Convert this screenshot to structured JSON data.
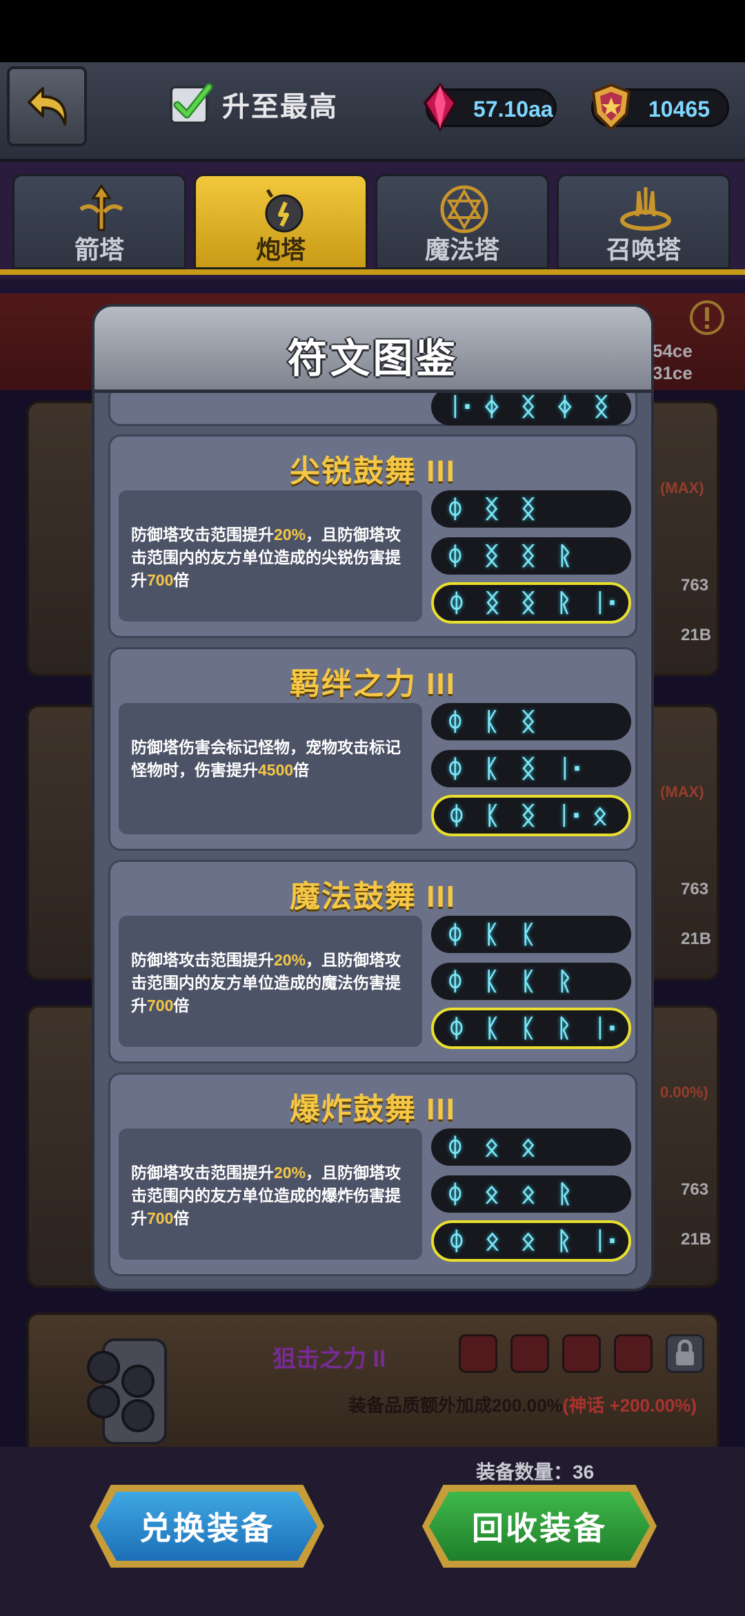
{
  "topbar": {
    "max_label": "升至最高",
    "gem_value": "57.10aa",
    "gold_value": "10465"
  },
  "tabs": [
    {
      "label": "箭塔",
      "active": false
    },
    {
      "label": "炮塔",
      "active": true
    },
    {
      "label": "魔法塔",
      "active": false
    },
    {
      "label": "召唤塔",
      "active": false
    }
  ],
  "modal": {
    "title": "符文图鉴",
    "top_partial_glyphs": [
      "ᛁ·",
      "ᛄ",
      "ᛝ",
      "ᛄ",
      "ᛝ"
    ],
    "cards": [
      {
        "title": "尖锐鼓舞 III",
        "desc_parts": [
          "防御塔攻击范围提升",
          "20%",
          "，且防御塔攻击范围内的友方单位造成的尖锐伤害提升",
          "700",
          "倍"
        ],
        "combos": [
          [
            "ᛰ",
            "ᛝ",
            "ᛝ"
          ],
          [
            "ᛰ",
            "ᛝ",
            "ᛝ",
            "ᚱ"
          ],
          [
            "ᛰ",
            "ᛝ",
            "ᛝ",
            "ᚱ",
            "ᛁ·"
          ]
        ]
      },
      {
        "title": "羁绊之力 III",
        "desc_parts": [
          "防御塔伤害会标记怪物，宠物攻击标记怪物时，伤害提升",
          "4500",
          "倍"
        ],
        "combos": [
          [
            "ᛰ",
            "ᛕ",
            "ᛝ"
          ],
          [
            "ᛰ",
            "ᛕ",
            "ᛝ",
            "ᛁ·"
          ],
          [
            "ᛰ",
            "ᛕ",
            "ᛝ",
            "ᛁ·",
            "ᛟ"
          ]
        ]
      },
      {
        "title": "魔法鼓舞 III",
        "desc_parts": [
          "防御塔攻击范围提升",
          "20%",
          "，且防御塔攻击范围内的友方单位造成的魔法伤害提升",
          "700",
          "倍"
        ],
        "combos": [
          [
            "ᛰ",
            "ᛕ",
            "ᛕ"
          ],
          [
            "ᛰ",
            "ᛕ",
            "ᛕ",
            "ᚱ"
          ],
          [
            "ᛰ",
            "ᛕ",
            "ᛕ",
            "ᚱ",
            "ᛁ·"
          ]
        ]
      },
      {
        "title": "爆炸鼓舞 III",
        "desc_parts": [
          "防御塔攻击范围提升",
          "20%",
          "，且防御塔攻击范围内的友方单位造成的爆炸伤害提升",
          "700",
          "倍"
        ],
        "combos": [
          [
            "ᛰ",
            "ᛟ",
            "ᛟ"
          ],
          [
            "ᛰ",
            "ᛟ",
            "ᛟ",
            "ᚱ"
          ],
          [
            "ᛰ",
            "ᛟ",
            "ᛟ",
            "ᚱ",
            "ᛁ·"
          ]
        ]
      }
    ]
  },
  "background": {
    "banner_vals": [
      "54ce",
      "31ce"
    ],
    "side_labels": [
      "(MAX)",
      "763",
      "21B",
      "(MAX)",
      "763",
      "21B",
      "0.00%)",
      "763",
      "21B"
    ],
    "bottom_card": {
      "rune_name": "狙击之力 II",
      "quality_text": "装备品质额外加成200.00%",
      "quality_bonus": "(神话 +200.00%)"
    }
  },
  "footer": {
    "equip_count": "装备数量：36",
    "exchange_label": "兑换装备",
    "recycle_label": "回收装备"
  },
  "colors": {
    "accent_gold": "#f5c746",
    "rune_cyan": "#7fe6f5",
    "best_combo_border": "#e9df2c",
    "modal_bg": "#51586c"
  }
}
